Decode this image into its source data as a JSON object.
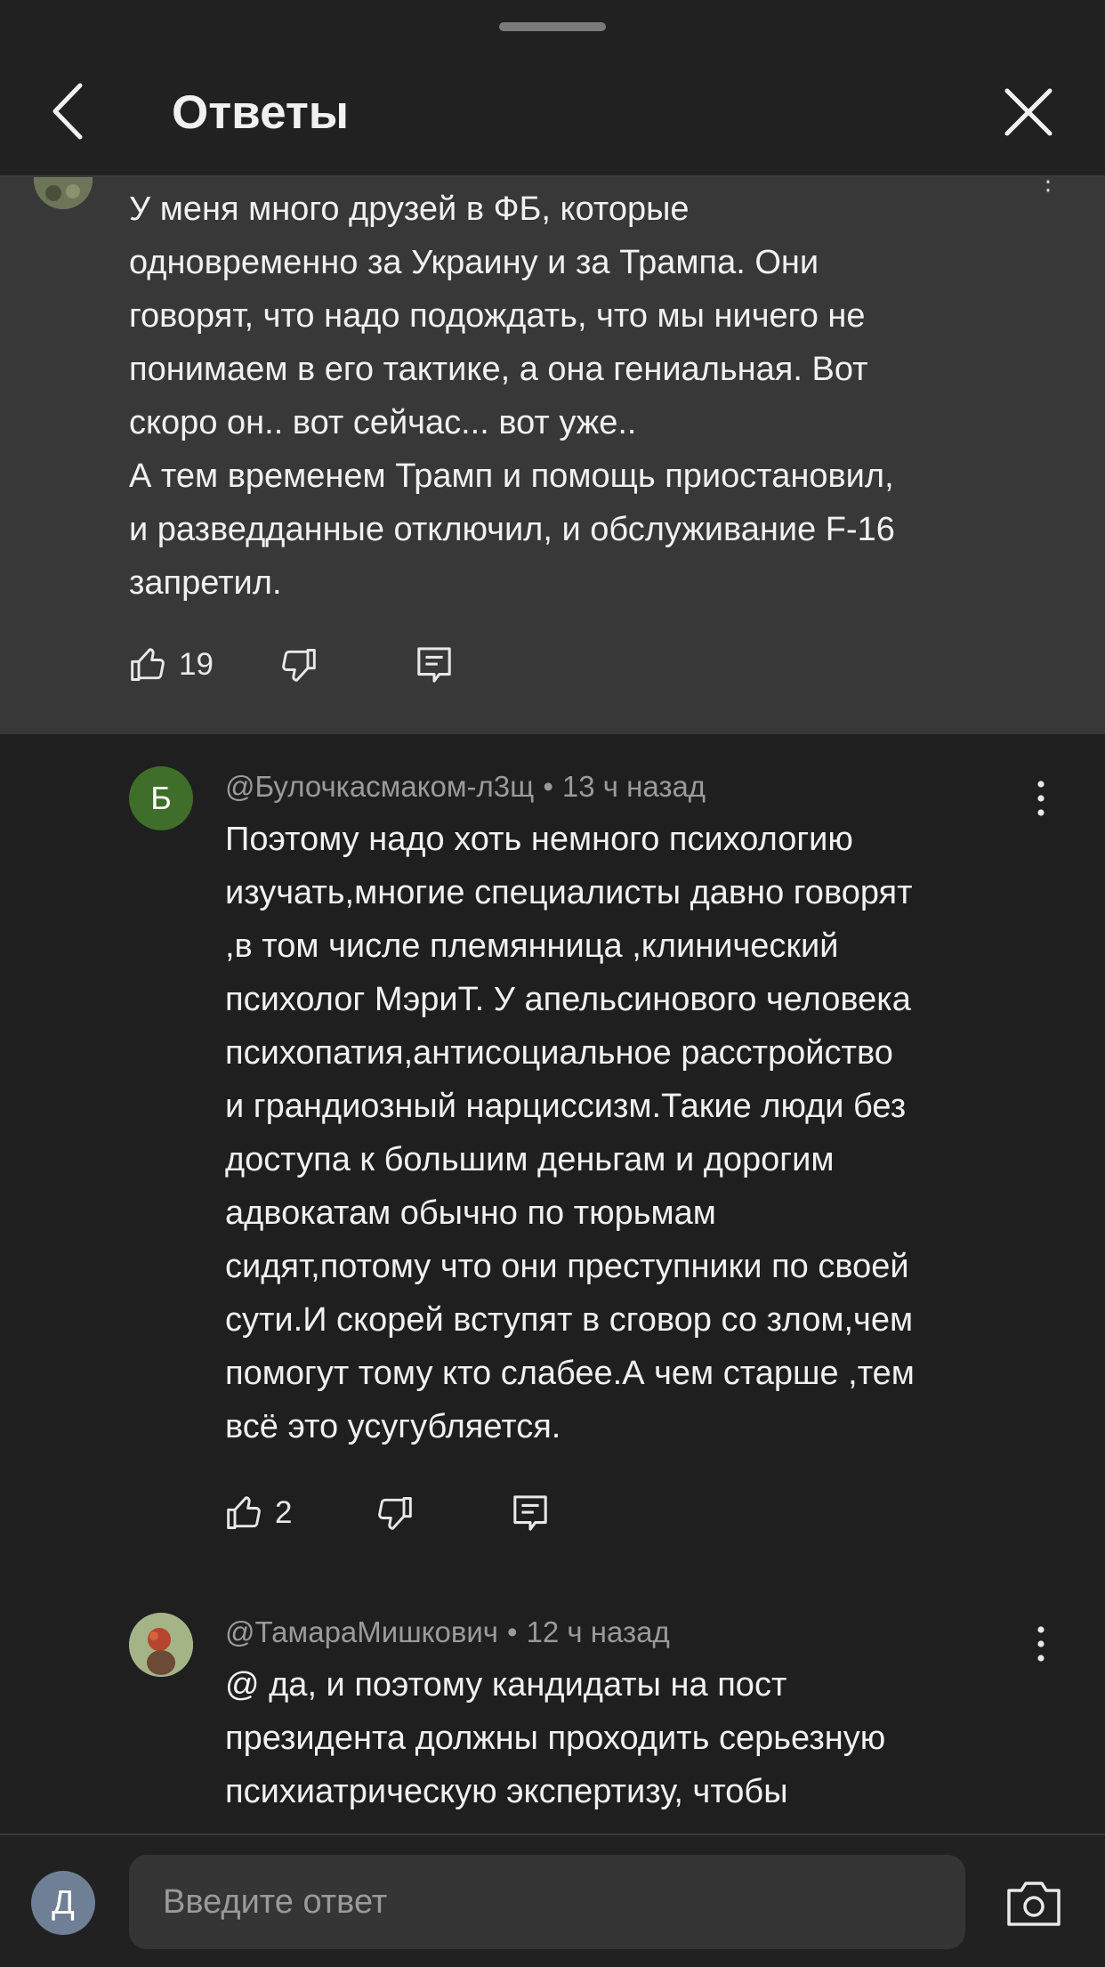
{
  "header": {
    "title": "Ответы"
  },
  "parent_comment": {
    "text": "У меня много друзей в ФБ, которые\nодновременно за Украину и за Трампа. Они\nговорят, что надо подождать, что мы ничего не\nпонимаем в его тактике, а она гениальная. Вот\nскоро он.. вот сейчас... вот уже..\nА тем временем Трамп и помощь приостановил,\nи разведданные отключил, и обслуживание F-16\nзапретил.",
    "likes": "19",
    "avatar_color": "#7c8566"
  },
  "replies": [
    {
      "avatar_letter": "Б",
      "avatar_color": "#3f6e2a",
      "author": "@Булочкасмаком-л3щ",
      "time": "13 ч назад",
      "text": "Поэтому надо хоть немного психологию\nизучать,многие специалисты давно говорят\n,в том числе племянница ,клинический\nпсихолог МэриТ. У апельсинового человека\nпсихопатия,антисоциальное расстройство\nи грандиозный нарциссизм.Такие люди без\nдоступа к большим деньгам и дорогим\nадвокатам обычно по тюрьмам\nсидят,потому что они преступники по своей\nсути.И скорей вступят в сговор со злом,чем\nпомогут тому кто слабее.А чем старше ,тем\nвсё это усугубляется.",
      "likes": "2"
    },
    {
      "avatar_letter": "",
      "avatar_color": "#a4b487",
      "author": "@ТамараМишкович",
      "time": "12 ч назад",
      "text": "@ да, и поэтому кандидаты на пост\nпрезидента должны проходить серьезную\nпсихиатрическую экспертизу, чтобы",
      "likes": ""
    }
  ],
  "footer": {
    "user_initial": "Д",
    "placeholder": "Введите ответ"
  },
  "separator": "•",
  "colors": {
    "background": "#1f1f1f",
    "highlight": "#383838",
    "text": "#f1f1f1",
    "meta": "#9a9a9a"
  }
}
